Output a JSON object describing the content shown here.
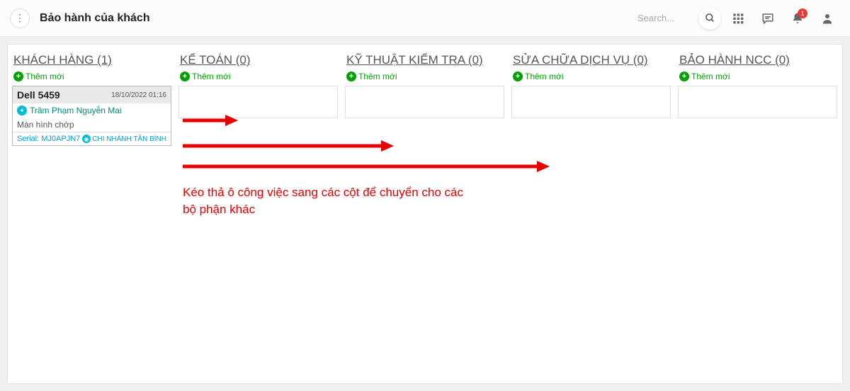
{
  "header": {
    "title": "Bảo hành của khách",
    "search_placeholder": "Search...",
    "notification_badge": "1"
  },
  "columns": [
    {
      "id": "khach-hang",
      "title": "KHÁCH HÀNG (1)",
      "add_label": "Thêm mới"
    },
    {
      "id": "ke-toan",
      "title": "KẾ TOÁN (0)",
      "add_label": "Thêm mới"
    },
    {
      "id": "ky-thuat",
      "title": "KỸ THUẬT KIỂM TRA (0)",
      "add_label": "Thêm mới"
    },
    {
      "id": "sua-chua",
      "title": "SỬA CHỮA DỊCH VỤ (0)",
      "add_label": "Thêm mới"
    },
    {
      "id": "bao-hanh-ncc",
      "title": "BẢO HÀNH NCC (0)",
      "add_label": "Thêm mới"
    }
  ],
  "card": {
    "title": "Dell 5459",
    "date": "18/10/2022 01:16",
    "customer": "Trâm Phạm Nguyễn Mai",
    "description": "Màn hình chớp",
    "serial_label": "Serial: MJ0APJN7",
    "branch": "CHI NHÁNH TÂN BÌNH"
  },
  "annotation": {
    "text": "Kéo thả ô công việc sang các cột để chuyển cho các bộ phận khác"
  }
}
